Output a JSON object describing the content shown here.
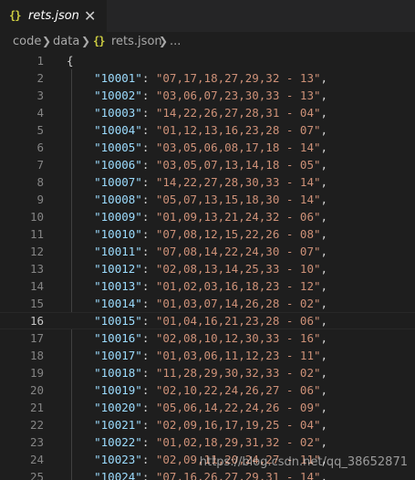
{
  "tab": {
    "icon": "{}",
    "label": "rets.json",
    "close": "✕"
  },
  "breadcrumb": {
    "items": [
      "code",
      "data"
    ],
    "file_icon": "{}",
    "file": "rets.json",
    "ellipsis": "..."
  },
  "editor": {
    "current_line": 16,
    "open_brace": "{",
    "entries": [
      {
        "key": "10001",
        "value": "07,17,18,27,29,32 - 13"
      },
      {
        "key": "10002",
        "value": "03,06,07,23,30,33 - 13"
      },
      {
        "key": "10003",
        "value": "14,22,26,27,28,31 - 04"
      },
      {
        "key": "10004",
        "value": "01,12,13,16,23,28 - 07"
      },
      {
        "key": "10005",
        "value": "03,05,06,08,17,18 - 14"
      },
      {
        "key": "10006",
        "value": "03,05,07,13,14,18 - 05"
      },
      {
        "key": "10007",
        "value": "14,22,27,28,30,33 - 14"
      },
      {
        "key": "10008",
        "value": "05,07,13,15,18,30 - 14"
      },
      {
        "key": "10009",
        "value": "01,09,13,21,24,32 - 06"
      },
      {
        "key": "10010",
        "value": "07,08,12,15,22,26 - 08"
      },
      {
        "key": "10011",
        "value": "07,08,14,22,24,30 - 07"
      },
      {
        "key": "10012",
        "value": "02,08,13,14,25,33 - 10"
      },
      {
        "key": "10013",
        "value": "01,02,03,16,18,23 - 12"
      },
      {
        "key": "10014",
        "value": "01,03,07,14,26,28 - 02"
      },
      {
        "key": "10015",
        "value": "01,04,16,21,23,28 - 06"
      },
      {
        "key": "10016",
        "value": "02,08,10,12,30,33 - 16"
      },
      {
        "key": "10017",
        "value": "01,03,06,11,12,23 - 11"
      },
      {
        "key": "10018",
        "value": "11,28,29,30,32,33 - 02"
      },
      {
        "key": "10019",
        "value": "02,10,22,24,26,27 - 06"
      },
      {
        "key": "10020",
        "value": "05,06,14,22,24,26 - 09"
      },
      {
        "key": "10021",
        "value": "02,09,16,17,19,25 - 04"
      },
      {
        "key": "10022",
        "value": "01,02,18,29,31,32 - 02"
      },
      {
        "key": "10023",
        "value": "02,09,11,20,24,27 - 11"
      },
      {
        "key": "10024",
        "value": "07,16,26,27,29,31 - 14"
      }
    ]
  },
  "watermark": "https://blog.csdn.net/qq_38652871"
}
